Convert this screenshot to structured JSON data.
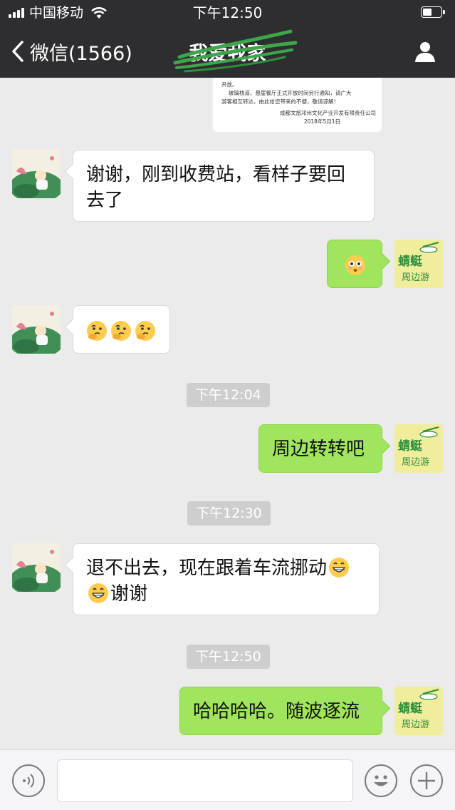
{
  "status_bar": {
    "carrier": "中国移动",
    "time": "下午12:50",
    "battery_level": 0.5
  },
  "nav": {
    "back_label": "微信(1566)",
    "title": "我爱我家"
  },
  "colors": {
    "accent_green": "#9fe65e",
    "bar_bg": "#2e2e31",
    "chat_bg": "#ebebeb",
    "timestamp_bg": "#cecece"
  },
  "notice_image": {
    "lines": [
      "开放。",
      "玻璃栈道、悬崖餐厅正式开放时间另行通知，请广大",
      "游客相互转达，由此给您带来的不便，敬请谅解！",
      "成都文旅邛州文化产业开发有限责任公司",
      "2018年5月1日"
    ]
  },
  "messages": [
    {
      "side": "left",
      "text": "谢谢，刚到收费站，看样子要回去了"
    },
    {
      "side": "right",
      "emoji": "flushed-face-emoji"
    },
    {
      "side": "left",
      "emoji": "thinking-face-emoji",
      "count": 3
    },
    {
      "timestamp": "下午12:04"
    },
    {
      "side": "right",
      "text": "周边转转吧"
    },
    {
      "timestamp": "下午12:30"
    },
    {
      "side": "left",
      "text_line1": "退不出去，现在跟着车流挪动",
      "text_line2": "谢谢",
      "emoji": "grinning-face-emoji"
    },
    {
      "timestamp": "下午12:50"
    },
    {
      "side": "right",
      "text": "哈哈哈哈。随波逐流"
    }
  ],
  "avatars": {
    "self_label_line1": "蜻蜓",
    "self_label_line2": "周边游"
  },
  "input_bar": {
    "placeholder": ""
  }
}
